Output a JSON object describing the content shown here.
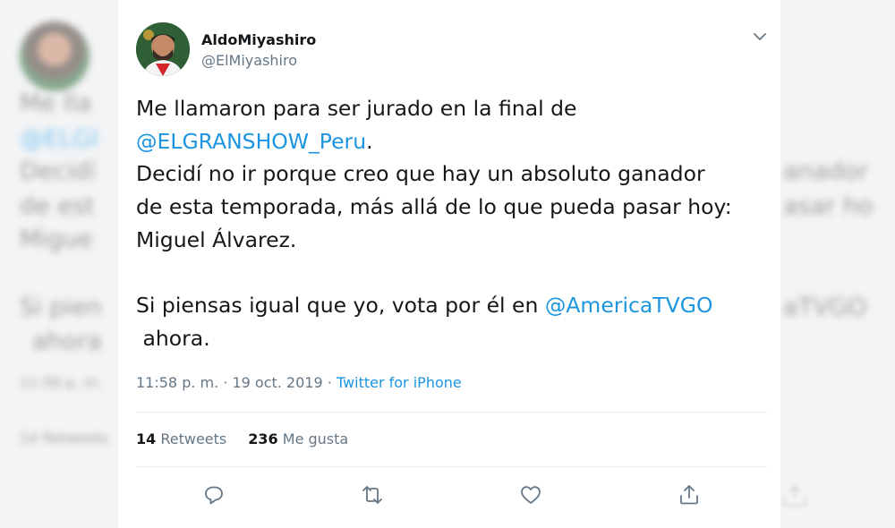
{
  "background": {
    "lines": [
      "Me lla",
      "@ELGI",
      "Decidí",
      "de est",
      "Migue",
      "Si pien",
      "ahora",
      "11:58 p. m.",
      "14 Retweets"
    ],
    "right_lines": [
      "anador",
      "asar ho",
      "aTVGO"
    ]
  },
  "tweet": {
    "author_name": "AldoMiyashiro",
    "author_handle": "@ElMiyashiro",
    "text_lines": [
      {
        "text": "Me llamaron para ser jurado en la final de"
      },
      {
        "mention": "@ELGRANSHOW_Peru",
        "after": "."
      },
      {
        "text": "Decidí no ir porque creo que hay un absoluto ganador"
      },
      {
        "text": "de esta temporada, más allá de lo que pueda pasar hoy:"
      },
      {
        "text": "Miguel Álvarez."
      },
      {
        "text": "Si piensas igual que yo, vota por él en ",
        "mention": "@AmericaTVGO"
      },
      {
        "text": " ahora."
      }
    ],
    "timestamp": "11:58 p. m. · 19 oct. 2019",
    "separator": " · ",
    "source": "Twitter for iPhone",
    "retweets_count": "14",
    "retweets_label": "Retweets",
    "likes_count": "236",
    "likes_label": "Me gusta"
  },
  "icons": {
    "reply": "speech-bubble-icon",
    "retweet": "retweet-icon",
    "like": "heart-icon",
    "share": "share-icon",
    "menu": "chevron-down-icon"
  },
  "colors": {
    "link": "#1b95e0",
    "text": "#14171a",
    "muted": "#657786"
  }
}
